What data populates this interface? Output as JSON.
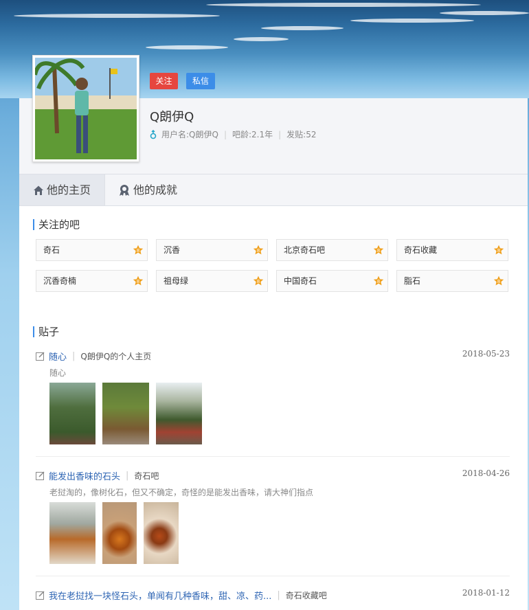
{
  "profile": {
    "username": "Q朗伊Q",
    "follow_label": "关注",
    "message_label": "私信",
    "meta_username": "用户名:Q朗伊Q",
    "meta_age": "吧龄:2.1年",
    "meta_posts": "发贴:52"
  },
  "tabs": [
    {
      "label": "他的主页",
      "icon": "home-icon"
    },
    {
      "label": "他的成就",
      "icon": "medal-icon"
    }
  ],
  "followed_bars": {
    "title": "关注的吧",
    "items": [
      "奇石",
      "沉香",
      "北京奇石吧",
      "奇石收藏",
      "沉香奇楠",
      "祖母绿",
      "中国奇石",
      "脂石"
    ]
  },
  "posts_section": {
    "title": "贴子",
    "posts": [
      {
        "title": "随心",
        "bar": "Q朗伊Q的个人主页",
        "date": "2018-05-23",
        "excerpt": "随心"
      },
      {
        "title": "能发出香味的石头",
        "bar": "奇石吧",
        "date": "2018-04-26",
        "excerpt": "老挝淘的，像树化石，但又不确定，奇怪的是能发出香味，请大神们指点"
      },
      {
        "title": "我在老挝找一块怪石头，单闻有几种香味，甜、凉、药...",
        "bar": "奇石收藏吧",
        "date": "2018-01-12",
        "excerpt": ""
      }
    ]
  },
  "colors": {
    "accent_blue": "#3c8de8",
    "follow_red": "#e6463f",
    "star_orange": "#f0a11e",
    "title_link": "#2d64b3"
  }
}
